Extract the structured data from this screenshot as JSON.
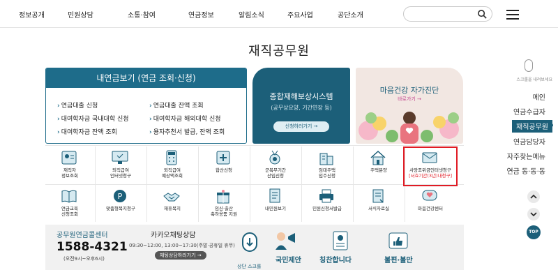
{
  "nav": {
    "items": [
      "정보공개",
      "민원상담",
      "소통·참여",
      "연금정보",
      "알림소식",
      "주요사업",
      "공단소개"
    ],
    "search_placeholder": ""
  },
  "page_title": "재직공무원",
  "loan_card": {
    "header": "내연금보기 (연금 조회·신청)",
    "links": [
      "연금대출 신청",
      "연금대출 잔액 조회",
      "대여학자금 국내대학 신청",
      "대여학자금 해외대학 신청",
      "대여학자금 잔액 조회",
      "용자추천서 발급, 잔액 조회"
    ]
  },
  "comp_card": {
    "title": "종합재해보상시스템",
    "subtitle": "(공무상요양, 기간연장 등)",
    "button": "신청하러가기 →"
  },
  "mind_card": {
    "title": "마음건강 자가진단",
    "link": "바로가기 →"
  },
  "grid": {
    "row1": [
      {
        "label": "재직자\n정보조회"
      },
      {
        "label": "퇴직급여\n인터넷청구"
      },
      {
        "label": "퇴직급여\n예상액조회"
      },
      {
        "label": "합산신청"
      },
      {
        "label": "군복무기간\n산입신청"
      },
      {
        "label": "임대주택\n입주신청"
      },
      {
        "label": "주택분양"
      },
      {
        "label": "사망조위금인터넷청구",
        "note": "[서효기간(3년)내청구]"
      }
    ],
    "row2": [
      {
        "label": "연금교육\n신청조회"
      },
      {
        "label": "맞춤형복지청구"
      },
      {
        "label": "재휴복지"
      },
      {
        "label": "임신·출산\n축하용품 지원"
      },
      {
        "label": "내민원보기"
      },
      {
        "label": "민원신청서발급"
      },
      {
        "label": "서식자료실"
      },
      {
        "label": "마음건강센터"
      }
    ]
  },
  "bottom": {
    "center_title": "공무원연금콜센터",
    "phone": "1588-4321",
    "hours": "(오전9시~오후6시)",
    "kakao_title": "카카오채팅상담",
    "kakao_hours": "09:30~12:00, 13:00~17:30(주말·공휴일 휴무)",
    "kakao_button": "채팅상담하러가기 →",
    "scroll_label": "상단 스크롤",
    "proposal": "국민제안",
    "praise": "칭찬합니다",
    "complaint": "불편·불만"
  },
  "side": {
    "scroll_hint": "스크롤을 내려보세요",
    "items": [
      "메인",
      "연금수급자",
      "재직공무원",
      "연금담당자",
      "자주찾는메뉴",
      "연금 동·동·동"
    ],
    "top": "TOP"
  }
}
